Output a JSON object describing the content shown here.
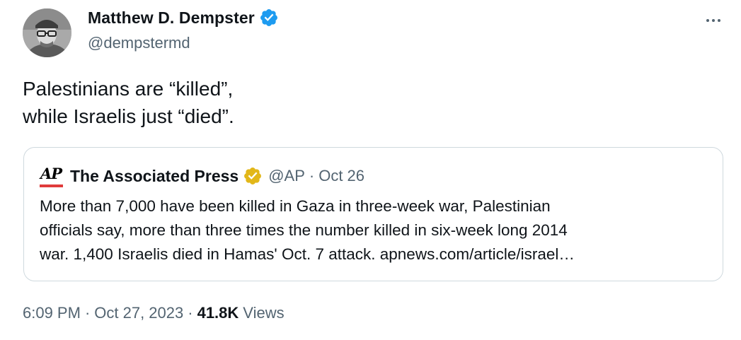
{
  "author": {
    "name": "Matthew D. Dempster",
    "handle": "@dempstermd",
    "verified_badge": "blue-verified-check",
    "badge_color": "#1d9bf0"
  },
  "tweet": {
    "lines": [
      "Palestinians are “killed”,",
      "while Israelis just “died”."
    ]
  },
  "quoted": {
    "logo": "AP",
    "name": "The Associated Press",
    "badge": "gold-verified-check",
    "badge_color": "#e2b719",
    "handle": "@AP",
    "separator": "·",
    "date": "Oct 26",
    "lines": [
      "More than 7,000 have been killed in Gaza in three-week war, Palestinian",
      "officials say, more than three times the number killed in six-week long 2014",
      "war. 1,400 Israelis died in Hamas' Oct. 7 attack. apnews.com/article/israel…"
    ]
  },
  "meta": {
    "time": "6:09 PM",
    "separator": "·",
    "date": "Oct 27, 2023",
    "views_count": "41.8K",
    "views_label": "Views"
  },
  "icons": {
    "more": "more-horizontal-icon"
  }
}
